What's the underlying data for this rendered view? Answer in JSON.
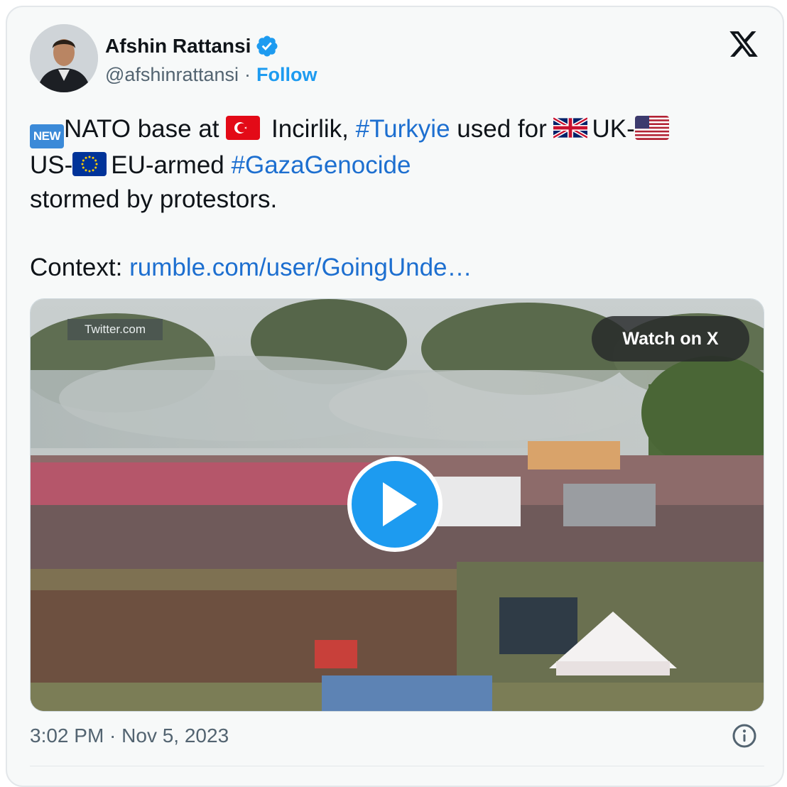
{
  "author": {
    "name": "Afshin Rattansi",
    "handle": "@afshinrattansi",
    "separator": "·",
    "follow_label": "Follow"
  },
  "icons": {
    "verified": "verified-badge-icon",
    "logo": "x-logo-icon",
    "info": "info-icon",
    "play": "play-icon"
  },
  "tweet": {
    "new_badge": "NEW",
    "line1_a": "NATO base at ",
    "line1_b": " Incirlik, ",
    "hashtag_turkyie": "#Turkyie",
    "line1_c": " used for ",
    "line1_d": "UK-",
    "line2_a": "US-",
    "line2_b": "EU-armed ",
    "hashtag_gaza": "#GazaGenocide",
    "line3": "stormed by protestors.",
    "context_label": "Context: ",
    "context_link": "rumble.com/user/GoingUnde…"
  },
  "media": {
    "watermark": "Twitter.com",
    "watch_label": "Watch on X"
  },
  "footer": {
    "timestamp": "3:02 PM · Nov 5, 2023"
  },
  "colors": {
    "accent": "#1d9bf0",
    "link": "#1d6fd0",
    "text": "#0f1419",
    "secondary": "#536471",
    "card_bg": "#f7f9f9"
  }
}
